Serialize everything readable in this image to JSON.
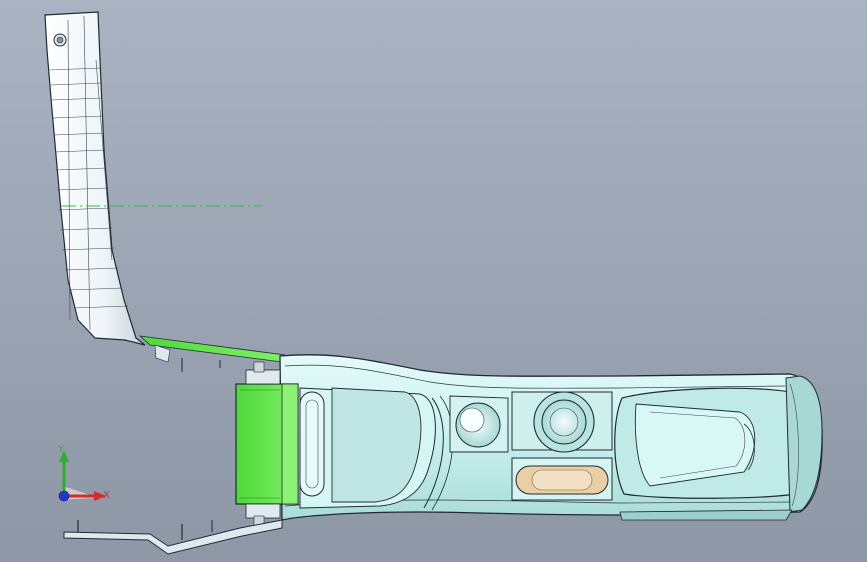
{
  "viewport": {
    "background_top": "#a9b3c2",
    "background_bottom": "#8e97a6"
  },
  "model": {
    "body_color": "#c8f2ef",
    "edge_color": "#1f2a33",
    "highlight_color": "#58e040",
    "detail_color": "#e8cfa6"
  },
  "triad": {
    "x_label": "X",
    "y_label": "Y",
    "x_color": "#d62b2b",
    "y_color": "#2fae2f",
    "z_color": "#2536c8"
  },
  "icons": {
    "triad": "axis-triad-icon"
  }
}
